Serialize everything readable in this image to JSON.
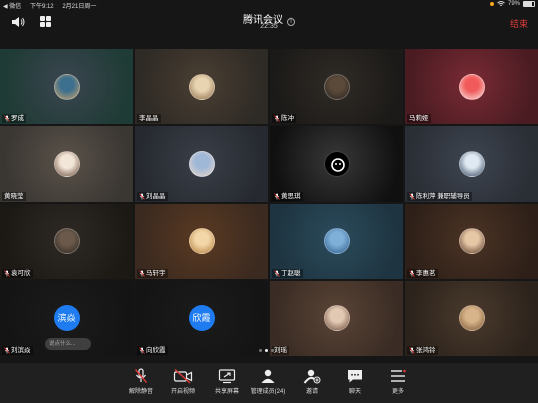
{
  "status_bar": {
    "back_label": "◀ 微信",
    "time": "下午9:12",
    "date": "2月21日周一",
    "battery": "79%",
    "battery_fraction": 0.79
  },
  "header": {
    "title": "腾讯会议",
    "duration": "22:35",
    "end_label": "结束"
  },
  "participants": [
    {
      "name": "罗成",
      "muted": true,
      "avatar": {
        "kind": "photo",
        "colors": [
          "#3d6f8f",
          "#c9a36b"
        ]
      },
      "bg": [
        "#3b4550",
        "#1f3b35"
      ]
    },
    {
      "name": "李晶晶",
      "muted": false,
      "avatar": {
        "kind": "photo",
        "colors": [
          "#e8d4b0",
          "#8b6a4a"
        ]
      },
      "bg": [
        "#4a3f33",
        "#2e2a25"
      ]
    },
    {
      "name": "陈冲",
      "muted": true,
      "avatar": {
        "kind": "photo",
        "colors": [
          "#5b4a3a",
          "#2a2320"
        ]
      },
      "bg": [
        "#2f2b26",
        "#1c1a18"
      ]
    },
    {
      "name": "马莉娅",
      "muted": false,
      "avatar": {
        "kind": "photo",
        "colors": [
          "#f05a5a",
          "#fbe3e3"
        ]
      },
      "bg": [
        "#7a2a34",
        "#4a1c22"
      ]
    },
    {
      "name": "黄晓莹",
      "muted": false,
      "avatar": {
        "kind": "photo",
        "colors": [
          "#f2e6d8",
          "#6a4a3a"
        ]
      },
      "bg": [
        "#5a524a",
        "#3a3632"
      ]
    },
    {
      "name": "刘晶晶",
      "muted": true,
      "avatar": {
        "kind": "photo",
        "colors": [
          "#9fb8d8",
          "#e9d6c6"
        ]
      },
      "bg": [
        "#3a3f48",
        "#262a30"
      ]
    },
    {
      "name": "黄思琪",
      "muted": true,
      "avatar": {
        "kind": "black",
        "colors": [
          "#000000",
          "#ffffff"
        ]
      },
      "bg": [
        "#383838",
        "#101010"
      ]
    },
    {
      "name": "陈利萍 兼职辅导员",
      "muted": true,
      "avatar": {
        "kind": "photo",
        "colors": [
          "#dfe9f2",
          "#2d3e55"
        ]
      },
      "bg": [
        "#3e4550",
        "#2a2e35"
      ]
    },
    {
      "name": "袁可欣",
      "muted": true,
      "avatar": {
        "kind": "photo",
        "colors": [
          "#6b5a4b",
          "#2e2620"
        ]
      },
      "bg": [
        "#2e2924",
        "#1c1915"
      ]
    },
    {
      "name": "马轩宇",
      "muted": true,
      "avatar": {
        "kind": "photo",
        "colors": [
          "#f3d7a8",
          "#b07a3a"
        ]
      },
      "bg": [
        "#5a3a22",
        "#3b2a20"
      ]
    },
    {
      "name": "丁赵聪",
      "muted": true,
      "avatar": {
        "kind": "photo",
        "colors": [
          "#7fb0d8",
          "#2a5a8a"
        ]
      },
      "bg": [
        "#2b4b5c",
        "#1e3440"
      ]
    },
    {
      "name": "李惠茗",
      "muted": true,
      "avatar": {
        "kind": "photo",
        "colors": [
          "#e6c7a6",
          "#5a3a28"
        ]
      },
      "bg": [
        "#4b3325",
        "#2e2018"
      ]
    },
    {
      "name": "刘滨焱",
      "muted": true,
      "avatar": {
        "kind": "text",
        "text": "滨焱"
      },
      "bg": [
        "#1b1b1b",
        "#141414"
      ]
    },
    {
      "name": "向欣霞",
      "muted": true,
      "avatar": {
        "kind": "text",
        "text": "欣霞"
      },
      "bg": [
        "#1b1b1b",
        "#141414"
      ]
    },
    {
      "name": "刘瑶",
      "muted": false,
      "avatar": {
        "kind": "photo",
        "colors": [
          "#e2c9b4",
          "#6b4b3a"
        ]
      },
      "bg": [
        "#5a4436",
        "#3a2c24"
      ]
    },
    {
      "name": "张鸿铃",
      "muted": true,
      "avatar": {
        "kind": "photo",
        "colors": [
          "#d8b48a",
          "#7a5434"
        ]
      },
      "bg": [
        "#4a3a2c",
        "#2c231c"
      ]
    }
  ],
  "comment_placeholder": "说点什么...",
  "pager": {
    "pages": 3,
    "current": 1
  },
  "toolbar": {
    "items": [
      {
        "label": "解除静音",
        "icon": "mic-off-icon"
      },
      {
        "label": "开启视频",
        "icon": "video-off-icon"
      },
      {
        "label": "共享屏幕",
        "icon": "share-screen-icon"
      },
      {
        "label": "管理成员(24)",
        "icon": "members-icon"
      },
      {
        "label": "邀请",
        "icon": "invite-icon"
      },
      {
        "label": "聊天",
        "icon": "chat-icon"
      },
      {
        "label": "更多",
        "icon": "more-icon"
      }
    ]
  },
  "colors": {
    "end": "#e03a3a",
    "mute": "#e03a3a",
    "text_avatar": "#1e7cf0"
  }
}
